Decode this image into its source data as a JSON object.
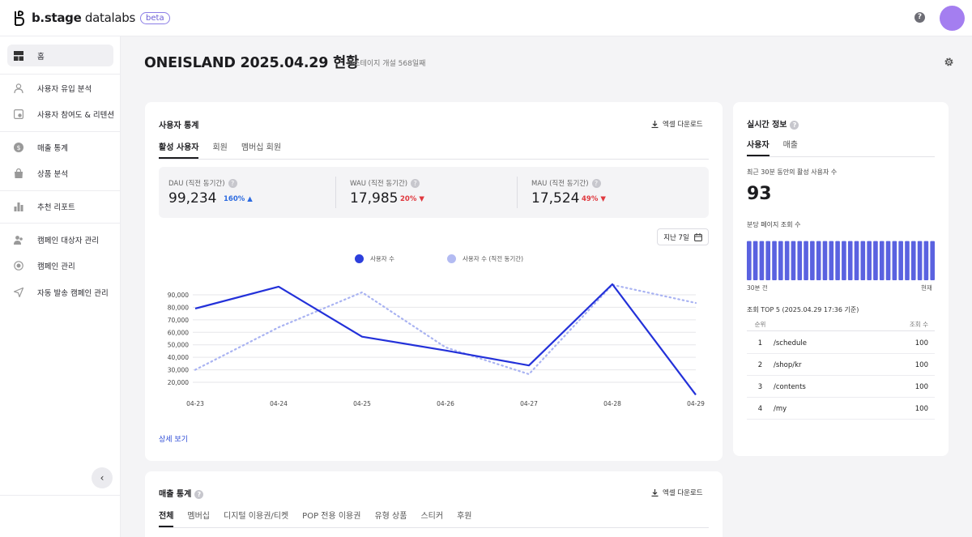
{
  "brand": {
    "name_bold": "b.stage",
    "name_thin": " datalabs",
    "badge": "beta"
  },
  "topbar": {
    "help_icon": "question-circle-icon",
    "avatar_color": "#a47ef0"
  },
  "sidebar": {
    "items": [
      {
        "label": "홈",
        "icon": "home-grid-icon",
        "active": true
      },
      {
        "label": "사용자 유입 분석",
        "icon": "user-icon"
      },
      {
        "label": "사용자 참여도 & 리텐션",
        "icon": "retention-icon"
      },
      {
        "label": "매출 통계",
        "icon": "dollar-icon"
      },
      {
        "label": "상품 분석",
        "icon": "bag-icon"
      },
      {
        "label": "추천 리포트",
        "icon": "bar-chart-icon"
      },
      {
        "label": "캠페인 대상자 관리",
        "icon": "users-icon"
      },
      {
        "label": "캠페인 관리",
        "icon": "target-icon"
      },
      {
        "label": "자동 발송 캠페인 관리",
        "icon": "send-icon"
      }
    ],
    "collapse_icon": "chevron-left-icon"
  },
  "page": {
    "title": "ONEISLAND 2025.04.29 현황",
    "subtitle": "비스테이지 개설 568일째",
    "settings_icon": "gear-icon"
  },
  "user_stats": {
    "title": "사용자 통계",
    "excel_label": "엑셀 다운로드",
    "tabs": [
      "활성 사용자",
      "회원",
      "멤버십 회원"
    ],
    "metrics": [
      {
        "label": "DAU (직전 동기간)",
        "value": "99,234",
        "delta": "160%",
        "direction": "up",
        "color": "#2d6be0"
      },
      {
        "label": "WAU (직전 동기간)",
        "value": "17,985",
        "delta": "20%",
        "direction": "down",
        "color": "#e0383e"
      },
      {
        "label": "MAU (직전 동기간)",
        "value": "17,524",
        "delta": "49%",
        "direction": "down",
        "color": "#e0383e"
      }
    ],
    "period_label": "지난 7일",
    "period_icon": "calendar-icon",
    "detail_link": "상세 보기"
  },
  "chart_data": {
    "type": "line",
    "x": [
      "04-23",
      "04-24",
      "04-25",
      "04-26",
      "04-27",
      "04-28",
      "04-29"
    ],
    "series": [
      {
        "name": "사용자 수",
        "values": [
          79000,
          96500,
          56500,
          45500,
          33500,
          98500,
          10000
        ],
        "color": "#2331d9",
        "style": "solid"
      },
      {
        "name": "사용자 수 (직전 동기간)",
        "values": [
          30000,
          64000,
          92000,
          48000,
          26500,
          98000,
          83500
        ],
        "color": "#a9b3f2",
        "style": "dotted"
      }
    ],
    "yticks": [
      "90,000",
      "80,000",
      "70,000",
      "60,000",
      "50,000",
      "40,000",
      "30,000",
      "20,000"
    ],
    "ylim": [
      20000,
      90000
    ],
    "grid": true,
    "legend": "top-center"
  },
  "realtime": {
    "title": "실시간 정보",
    "tabs": [
      "사용자",
      "매출"
    ],
    "active_caption": "최근 30분 동안의 활성 사용자 수",
    "active_value": "93",
    "pageview_caption": "분당 페이지 조회 수",
    "bars": [
      0.93,
      0.93,
      0.93,
      0.93,
      0.93,
      0.93,
      0.93,
      0.93,
      0.93,
      0.93,
      0.93,
      0.93,
      0.93,
      0.93,
      0.93,
      0.93,
      0.93,
      0.93,
      0.93,
      0.93,
      0.93,
      0.93,
      0.93,
      0.93,
      0.93,
      0.93,
      0.93,
      0.93,
      0.93,
      0.93
    ],
    "bar_color": "#5a62e0",
    "axis_start": "30분 전",
    "axis_end": "현재",
    "top5_title": "조회 TOP 5 (2025.04.29 17:36 기준)",
    "top5_headers": {
      "rank": "순위",
      "views": "조회 수"
    },
    "top5": [
      {
        "rank": "1",
        "page": "/schedule",
        "views": "100"
      },
      {
        "rank": "2",
        "page": "/shop/kr",
        "views": "100"
      },
      {
        "rank": "3",
        "page": "/contents",
        "views": "100"
      },
      {
        "rank": "4",
        "page": "/my",
        "views": "100"
      }
    ]
  },
  "sales_stats": {
    "title": "매출 통계",
    "excel_label": "엑셀 다운로드",
    "tabs": [
      "전체",
      "멤버십",
      "디지털 이용권/티켓",
      "POP 전용 이용권",
      "유형 상품",
      "스티커",
      "후원"
    ]
  }
}
